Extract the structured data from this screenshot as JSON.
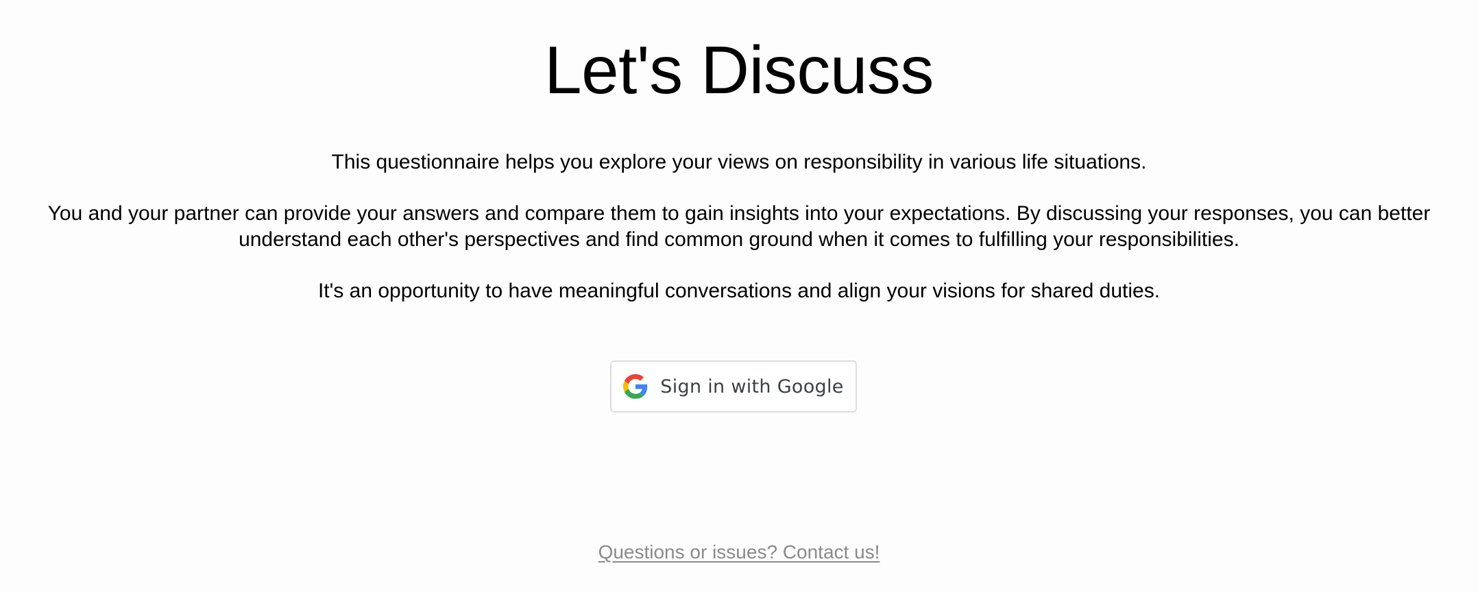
{
  "header": {
    "title": "Let's Discuss"
  },
  "intro": {
    "paragraphs": [
      "This questionnaire helps you explore your views on responsibility in various life situations.",
      "You and your partner can provide your answers and compare them to gain insights into your expectations. By discussing your responses, you can better understand each other's perspectives and find common ground when it comes to fulfilling your responsibilities.",
      "It's an opportunity to have meaningful conversations and align your visions for shared duties."
    ]
  },
  "auth": {
    "google_button_label": "Sign in with Google",
    "icon": "google-g-icon"
  },
  "footer": {
    "contact_link": "Questions or issues? Contact us!"
  },
  "colors": {
    "background": "#fdfdfd",
    "text": "#000000",
    "button_border": "#dadce0",
    "button_text": "#3c4043",
    "footer_link": "#8a8a8a",
    "google_blue": "#4285f4",
    "google_red": "#ea4335",
    "google_yellow": "#fbbc05",
    "google_green": "#34a853"
  }
}
